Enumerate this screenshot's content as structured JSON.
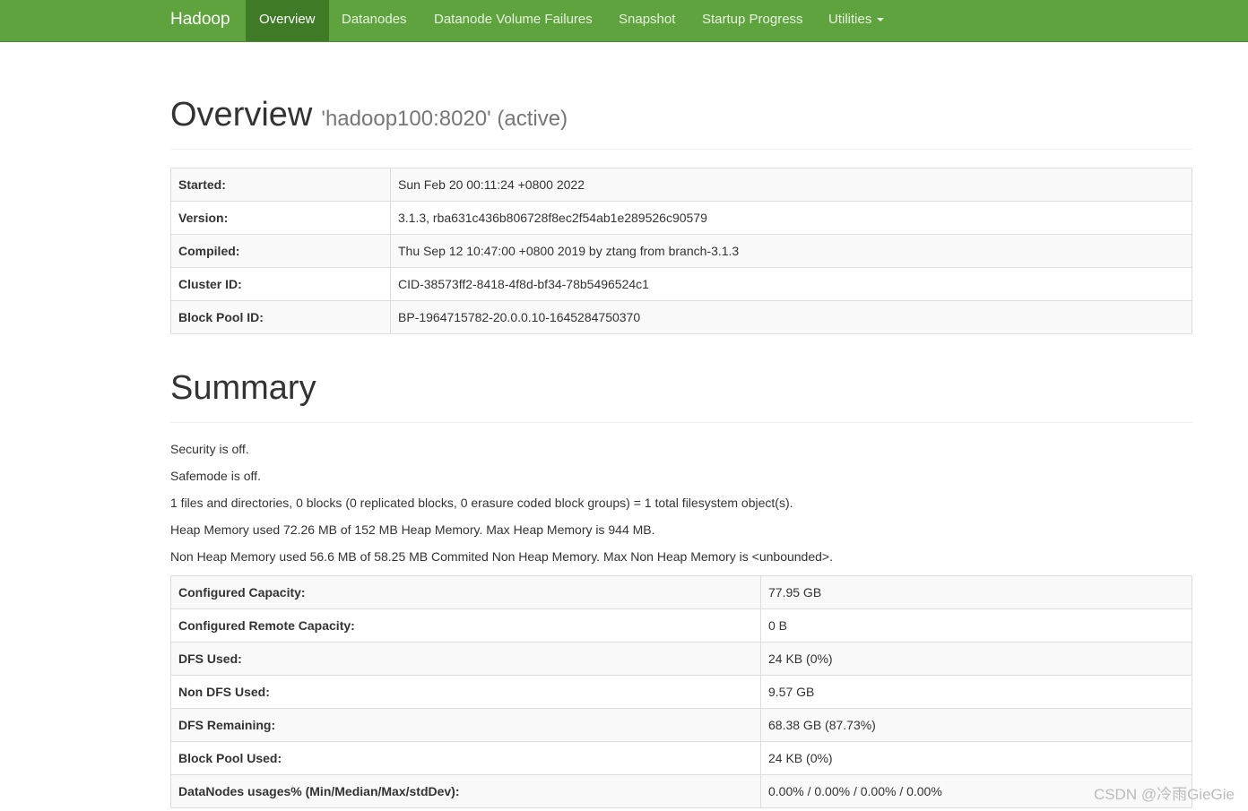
{
  "navbar": {
    "brand": "Hadoop",
    "items": [
      {
        "label": "Overview",
        "active": true
      },
      {
        "label": "Datanodes"
      },
      {
        "label": "Datanode Volume Failures"
      },
      {
        "label": "Snapshot"
      },
      {
        "label": "Startup Progress"
      },
      {
        "label": "Utilities",
        "dropdown": true
      }
    ],
    "colors": {
      "background": "#5fa33e",
      "active": "#3f7a26"
    }
  },
  "overview": {
    "title": "Overview",
    "subtitle": "'hadoop100:8020' (active)",
    "rows": [
      {
        "key": "Started:",
        "value": "Sun Feb 20 00:11:24 +0800 2022"
      },
      {
        "key": "Version:",
        "value": "3.1.3, rba631c436b806728f8ec2f54ab1e289526c90579"
      },
      {
        "key": "Compiled:",
        "value": "Thu Sep 12 10:47:00 +0800 2019 by ztang from branch-3.1.3"
      },
      {
        "key": "Cluster ID:",
        "value": "CID-38573ff2-8418-4f8d-bf34-78b5496524c1"
      },
      {
        "key": "Block Pool ID:",
        "value": "BP-1964715782-20.0.0.10-1645284750370"
      }
    ]
  },
  "summary": {
    "title": "Summary",
    "lines": [
      "Security is off.",
      "Safemode is off.",
      "1 files and directories, 0 blocks (0 replicated blocks, 0 erasure coded block groups) = 1 total filesystem object(s).",
      "Heap Memory used 72.26 MB of 152 MB Heap Memory. Max Heap Memory is 944 MB.",
      "Non Heap Memory used 56.6 MB of 58.25 MB Commited Non Heap Memory. Max Non Heap Memory is <unbounded>."
    ],
    "rows": [
      {
        "key": "Configured Capacity:",
        "value": "77.95 GB"
      },
      {
        "key": "Configured Remote Capacity:",
        "value": "0 B"
      },
      {
        "key": "DFS Used:",
        "value": "24 KB (0%)"
      },
      {
        "key": "Non DFS Used:",
        "value": "9.57 GB"
      },
      {
        "key": "DFS Remaining:",
        "value": "68.38 GB (87.73%)"
      },
      {
        "key": "Block Pool Used:",
        "value": "24 KB (0%)"
      },
      {
        "key": "DataNodes usages% (Min/Median/Max/stdDev):",
        "value": "0.00% / 0.00% / 0.00% / 0.00%"
      }
    ]
  },
  "watermark": "CSDN @冷雨GieGie"
}
